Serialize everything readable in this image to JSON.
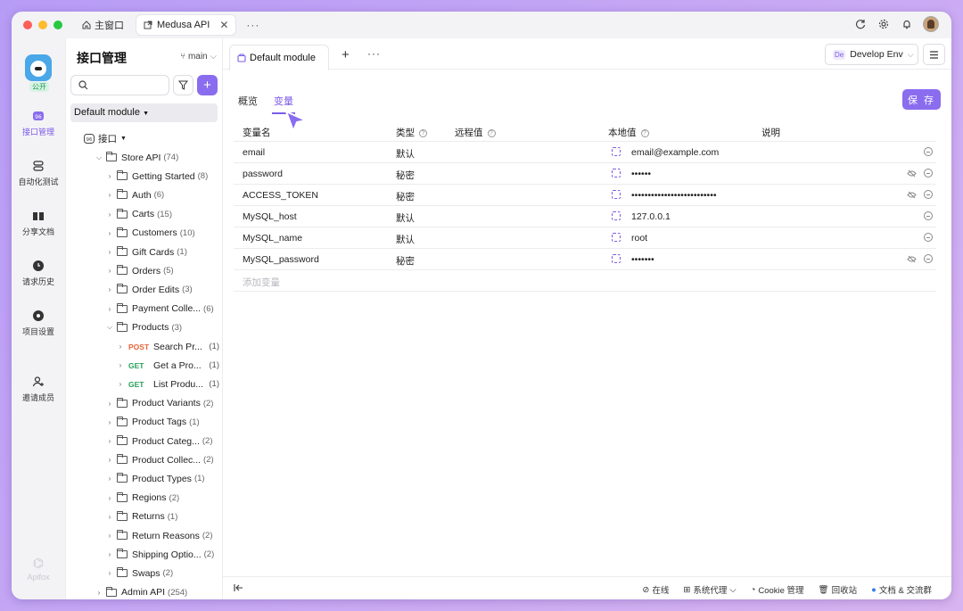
{
  "titlebar": {
    "home_tab": "主窗口",
    "active_tab": "Medusa API",
    "more": "···"
  },
  "rail": {
    "badge": "公开",
    "items": [
      {
        "label": "接口管理"
      },
      {
        "label": "自动化测试"
      },
      {
        "label": "分享文档"
      },
      {
        "label": "请求历史"
      },
      {
        "label": "项目设置"
      },
      {
        "label": "邀请成员"
      }
    ],
    "footer": "Apifox"
  },
  "sidebar": {
    "title": "接口管理",
    "branch": "main",
    "module": "Default module",
    "root": "接口",
    "nodes": [
      {
        "label": "Store API",
        "count": "(74)"
      },
      {
        "label": "Getting Started",
        "count": "(8)"
      },
      {
        "label": "Auth",
        "count": "(6)"
      },
      {
        "label": "Carts",
        "count": "(15)"
      },
      {
        "label": "Customers",
        "count": "(10)"
      },
      {
        "label": "Gift Cards",
        "count": "(1)"
      },
      {
        "label": "Orders",
        "count": "(5)"
      },
      {
        "label": "Order Edits",
        "count": "(3)"
      },
      {
        "label": "Payment Colle...",
        "count": "(6)"
      },
      {
        "label": "Products",
        "count": "(3)"
      },
      {
        "method": "POST",
        "label": "Search Pr...",
        "count": "(1)"
      },
      {
        "method": "GET",
        "label": "Get a Pro...",
        "count": "(1)"
      },
      {
        "method": "GET",
        "label": "List Produ...",
        "count": "(1)"
      },
      {
        "label": "Product Variants",
        "count": "(2)"
      },
      {
        "label": "Product Tags",
        "count": "(1)"
      },
      {
        "label": "Product Categ...",
        "count": "(2)"
      },
      {
        "label": "Product Collec...",
        "count": "(2)"
      },
      {
        "label": "Product Types",
        "count": "(1)"
      },
      {
        "label": "Regions",
        "count": "(2)"
      },
      {
        "label": "Returns",
        "count": "(1)"
      },
      {
        "label": "Return Reasons",
        "count": "(2)"
      },
      {
        "label": "Shipping Optio...",
        "count": "(2)"
      },
      {
        "label": "Swaps",
        "count": "(2)"
      },
      {
        "label": "Admin API",
        "count": "(254)"
      }
    ]
  },
  "main": {
    "tab": "Default module",
    "env": {
      "badge": "De",
      "label": "Develop Env"
    },
    "subtabs": [
      "概览",
      "变量"
    ],
    "save": "保 存",
    "columns": [
      "变量名",
      "类型",
      "远程值",
      "本地值",
      "说明"
    ],
    "rows": [
      {
        "name": "email",
        "type": "默认",
        "local": "email@example.com",
        "secret": false
      },
      {
        "name": "password",
        "type": "秘密",
        "local": "••••••",
        "secret": true
      },
      {
        "name": "ACCESS_TOKEN",
        "type": "秘密",
        "local": "••••••••••••••••••••••••••",
        "secret": true
      },
      {
        "name": "MySQL_host",
        "type": "默认",
        "local": "127.0.0.1",
        "secret": false
      },
      {
        "name": "MySQL_name",
        "type": "默认",
        "local": "root",
        "secret": false
      },
      {
        "name": "MySQL_password",
        "type": "秘密",
        "local": "•••••••",
        "secret": true
      }
    ],
    "add_var": "添加变量"
  },
  "statusbar": {
    "online": "在线",
    "proxy": "系统代理",
    "cookie": "Cookie 管理",
    "trash": "回收站",
    "docs": "文档 & 交流群"
  },
  "colors": {
    "accent": "#8a6cef",
    "post": "#e8663a",
    "get": "#27a05a"
  }
}
